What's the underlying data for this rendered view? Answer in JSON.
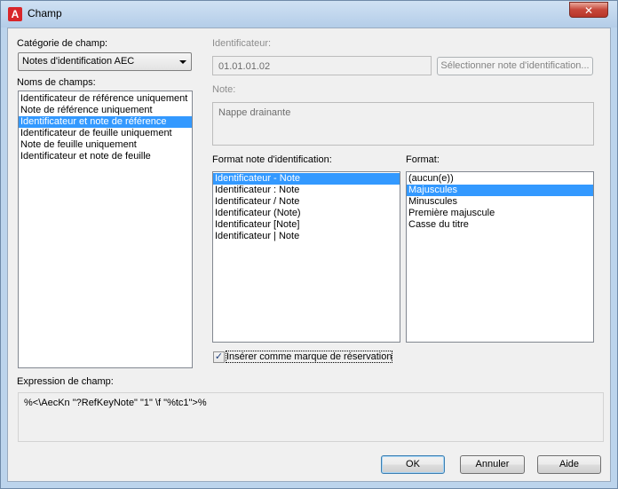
{
  "window": {
    "title": "Champ",
    "close_glyph": "✕",
    "app_icon_letter": "A"
  },
  "category": {
    "label": "Catégorie de champ:",
    "selected": "Notes d'identification AEC"
  },
  "field_names": {
    "label": "Noms de champs:",
    "items": [
      "Identificateur de référence uniquement",
      "Note de référence uniquement",
      "Identificateur et note de référence",
      "Identificateur de feuille uniquement",
      "Note de feuille uniquement",
      "Identificateur et note de feuille"
    ],
    "selected_index": 2
  },
  "identifier": {
    "label": "Identificateur:",
    "value": "01.01.01.02",
    "select_button": "Sélectionner note d'identification..."
  },
  "note": {
    "label": "Note:",
    "value": "Nappe drainante"
  },
  "keynote_format": {
    "label": "Format note d'identification:",
    "items": [
      "Identificateur - Note",
      "Identificateur : Note",
      "Identificateur / Note",
      "Identificateur (Note)",
      "Identificateur [Note]",
      "Identificateur | Note"
    ],
    "selected_index": 0
  },
  "format": {
    "label": "Format:",
    "items": [
      "(aucun(e))",
      "Majuscules",
      "Minuscules",
      "Première majuscule",
      "Casse du titre"
    ],
    "selected_index": 1
  },
  "placeholder_checkbox": {
    "label": "Insérer comme marque de réservation",
    "checked": true,
    "check_glyph": "✓"
  },
  "expression": {
    "label": "Expression de champ:",
    "value": "%<\\AecKn \"?RefKeyNote\" \"1\" \\f \"%tc1\">%"
  },
  "buttons": {
    "ok": "OK",
    "cancel": "Annuler",
    "help": "Aide"
  },
  "colors": {
    "selection": "#3399ff",
    "title_bar": "#bcd4ec",
    "close_button": "#c6473a"
  }
}
